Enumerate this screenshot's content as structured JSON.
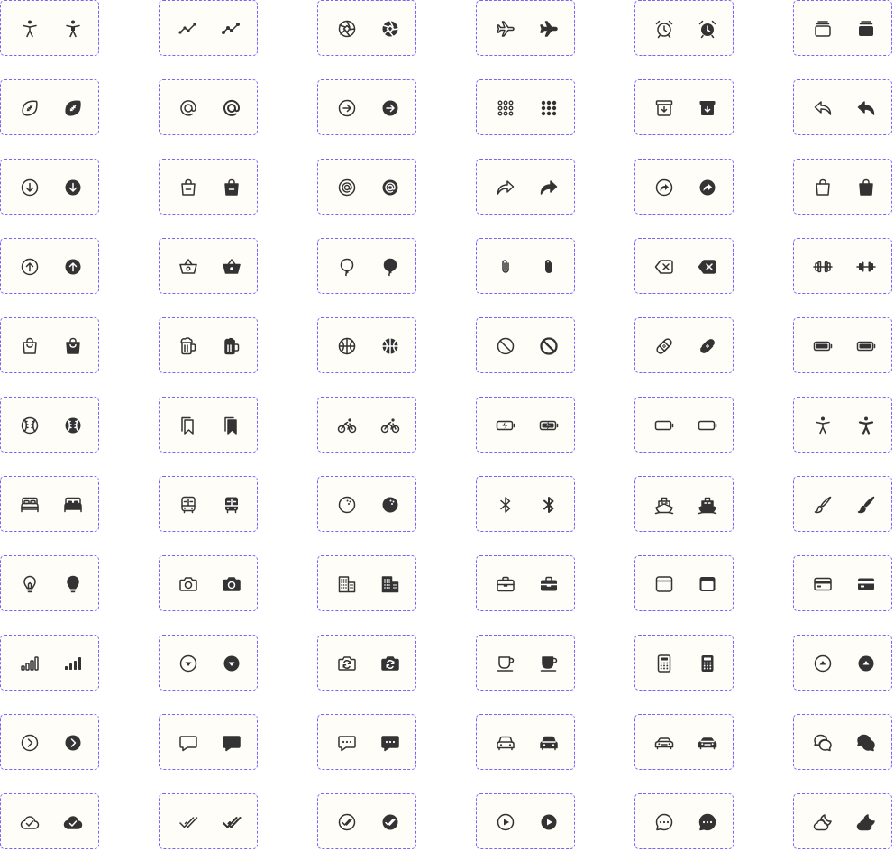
{
  "icon_color": "#333333",
  "border_color": "#7b61ff",
  "cell_background": "#fffdf7",
  "variants": [
    "outline",
    "fill"
  ],
  "rows": [
    [
      "accessibility",
      "activity",
      "aperture",
      "airplane",
      "alarm",
      "albums"
    ],
    [
      "american-football",
      "at-sign",
      "arrow-forward-circle",
      "apps",
      "archive",
      "arrow-undo"
    ],
    [
      "arrow-down-circle",
      "bag-remove",
      "at-circle",
      "arrow-redo",
      "arrow-redo-circle",
      "bag"
    ],
    [
      "arrow-up-circle",
      "basket",
      "balloon",
      "attach",
      "backspace",
      "barbell"
    ],
    [
      "bag-handle",
      "beer",
      "basketball",
      "ban",
      "bandage",
      "battery-full"
    ],
    [
      "baseball",
      "bookmarks",
      "bicycle",
      "battery-charging",
      "battery-dead",
      "body"
    ],
    [
      "bed",
      "bus",
      "bowling-ball",
      "bluetooth",
      "boat",
      "brush"
    ],
    [
      "bulb",
      "camera",
      "business",
      "briefcase",
      "browsers",
      "card"
    ],
    [
      "cellular",
      "caret-down-circle",
      "camera-reverse",
      "cafe",
      "calculator",
      "caret-up-circle"
    ],
    [
      "chevron-forward-circle",
      "chatbox",
      "chatbox-ellipses",
      "car",
      "car-sport",
      "chatbubbles"
    ],
    [
      "cloud-done",
      "checkmark-done",
      "checkmark-done-circle",
      "play-circle",
      "chatbubble-ellipses",
      "cloudy-night"
    ]
  ]
}
